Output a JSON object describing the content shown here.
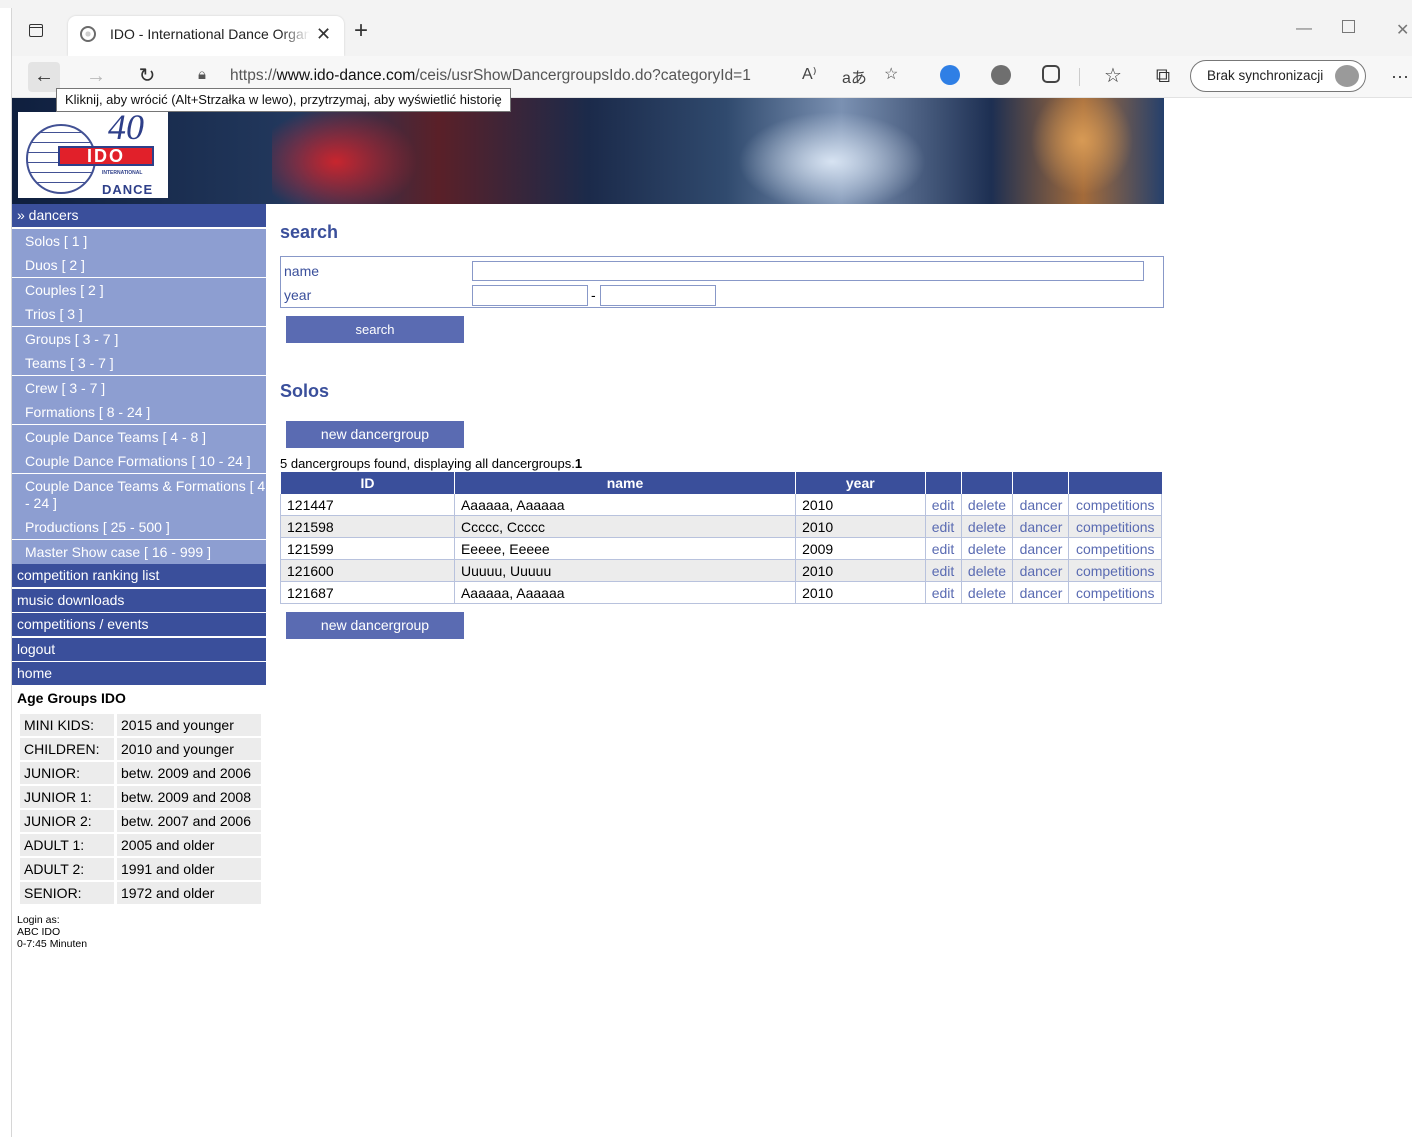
{
  "browser": {
    "tab_title": "IDO - International Dance Organization",
    "tab_close": "✕",
    "new_tab": "+",
    "url_prefix": "https://",
    "url_host": "www.ido-dance.com",
    "url_path": "/ceis/usrShowDancergroupsIdo.do?categoryId=1",
    "sync_label": "Brak synchronizacji",
    "tooltip": "Kliknij, aby wrócić (Alt+Strzałka w lewo), przytrzymaj, aby wyświetlić historię",
    "read_aloud": "A⁾",
    "translate": "aあ",
    "more": "···"
  },
  "logo": {
    "number": "40",
    "ido": "IDO",
    "sub": "INTERNATIONAL",
    "dance": "DANCE"
  },
  "sidebar": {
    "dancers": "» dancers",
    "sub_items": [
      "Solos [ 1 ]",
      "Duos [ 2 ]",
      "Couples [ 2 ]",
      "Trios [ 3 ]",
      "Groups [ 3 - 7 ]",
      "Teams [ 3 - 7 ]",
      "Crew [ 3 - 7 ]",
      "Formations [ 8 - 24 ]",
      "Couple Dance Teams [ 4 - 8 ]",
      "Couple Dance Formations [ 10 - 24 ]",
      "Couple Dance Teams & Formations [ 4 - 24 ]",
      "Productions [ 25 - 500 ]",
      "Master Show case [ 16 - 999 ]"
    ],
    "main_items": [
      "competition ranking list",
      "music downloads",
      "competitions / events",
      "logout",
      "home"
    ],
    "age_groups_title": "Age Groups IDO",
    "age_groups": [
      {
        "k": "MINI KIDS:",
        "v": "2015 and younger"
      },
      {
        "k": "CHILDREN:",
        "v": "2010 and younger"
      },
      {
        "k": "JUNIOR:",
        "v": "betw. 2009 and 2006"
      },
      {
        "k": "JUNIOR 1:",
        "v": "betw. 2009 and 2008"
      },
      {
        "k": "JUNIOR 2:",
        "v": "betw. 2007 and 2006"
      },
      {
        "k": "ADULT 1:",
        "v": "2005 and older"
      },
      {
        "k": "ADULT 2:",
        "v": "1991 and older"
      },
      {
        "k": "SENIOR:",
        "v": "1972 and older"
      }
    ],
    "login_label": "Login as:",
    "login_user": "ABC IDO",
    "login_time": "0-7:45 Minuten"
  },
  "main": {
    "search_title": "search",
    "name_label": "name",
    "year_label": "year",
    "name_value": "",
    "year_from": "",
    "year_to": "",
    "year_dash": "-",
    "search_button": "search",
    "section_title": "Solos",
    "new_button": "new dancergroup",
    "found_text": "5 dancergroups found, displaying all dancergroups.",
    "found_page": "1",
    "columns": [
      "ID",
      "name",
      "year",
      "",
      "",
      "",
      ""
    ],
    "rows": [
      {
        "id": "121447",
        "name": "Aaaaaa, Aaaaaa",
        "year": "2010"
      },
      {
        "id": "121598",
        "name": "Ccccc, Ccccc",
        "year": "2010"
      },
      {
        "id": "121599",
        "name": "Eeeee, Eeeee",
        "year": "2009"
      },
      {
        "id": "121600",
        "name": "Uuuuu, Uuuuu",
        "year": "2010"
      },
      {
        "id": "121687",
        "name": "Aaaaaa, Aaaaaa",
        "year": "2010"
      }
    ],
    "row_actions": [
      "edit",
      "delete",
      "dancer",
      "competitions"
    ]
  },
  "colors": {
    "nav_main": "#3a4f9b",
    "nav_sub": "#8d9ed1",
    "button": "#5a6bb2",
    "heading": "#3a4f9b"
  }
}
